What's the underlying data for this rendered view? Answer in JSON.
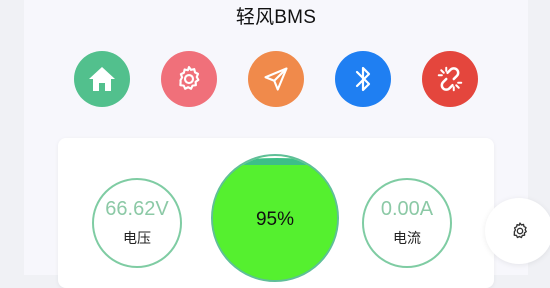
{
  "header": {
    "title": "轻风BMS"
  },
  "toolbar": [
    {
      "name": "home-button",
      "icon": "home-icon",
      "color": "#52c08d"
    },
    {
      "name": "settings-button",
      "icon": "gear-icon",
      "color": "#f0707a"
    },
    {
      "name": "send-button",
      "icon": "send-icon",
      "color": "#f08a4b"
    },
    {
      "name": "bluetooth-button",
      "icon": "bluetooth-icon",
      "color": "#1f7ff2"
    },
    {
      "name": "disconnect-button",
      "icon": "unlink-icon",
      "color": "#e4463d"
    }
  ],
  "status": {
    "voltage": {
      "value": "66.62V",
      "label": "电压"
    },
    "soc": {
      "value": "95%",
      "level": 0.95,
      "color": "#55f02f"
    },
    "current": {
      "value": "0.00A",
      "label": "电流"
    }
  },
  "floating": {
    "icon": "gear-icon"
  }
}
